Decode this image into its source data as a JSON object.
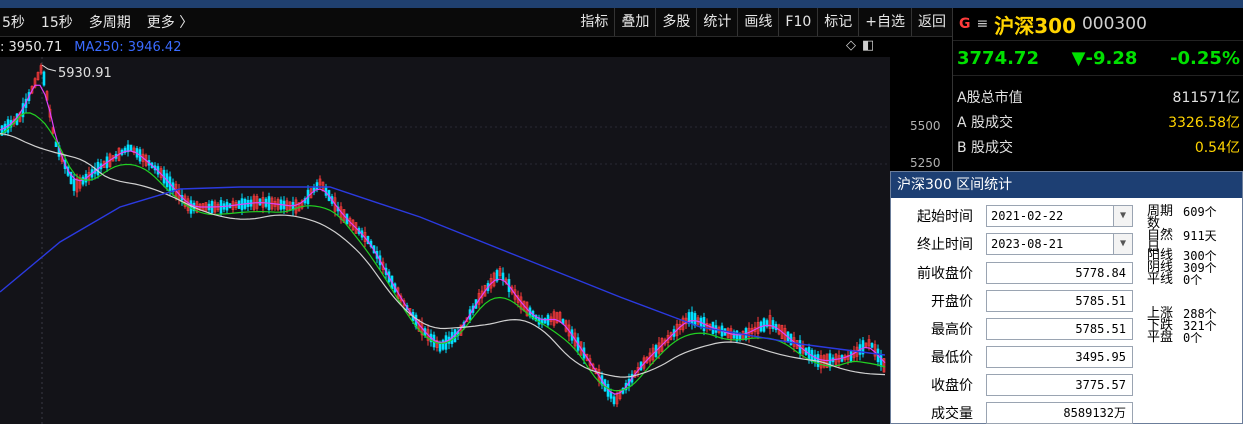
{
  "toolbar": {
    "left": [
      "5秒",
      "15秒",
      "多周期",
      "更多 〉"
    ],
    "right": [
      "指标",
      "叠加",
      "多股",
      "统计",
      "画线",
      "F10",
      "标记",
      "+自选",
      "返回"
    ]
  },
  "ma_line": {
    "ma1": ": 3950.71",
    "ma2": "MA250: 3946.42"
  },
  "chart": {
    "peak_label": "5930.91",
    "y_ticks": [
      "5500",
      "5250"
    ]
  },
  "quote": {
    "g_badge": "G",
    "menu_glyph": "≡",
    "name": "沪深300",
    "code": "000300",
    "price": "3774.72",
    "change": "▼-9.28",
    "pct": "-0.25%",
    "rows": [
      {
        "label": "A股总市值",
        "value": "811571亿",
        "yellow": false
      },
      {
        "label": "A 股成交",
        "value": "3326.58亿",
        "yellow": true
      },
      {
        "label": "B 股成交",
        "value": "0.54亿",
        "yellow": true
      }
    ]
  },
  "dialog": {
    "title": "沪深300 区间统计",
    "start_label": "起始时间",
    "start_value": "2021-02-22",
    "end_label": "终止时间",
    "end_value": "2023-08-21",
    "fields": [
      {
        "label": "前收盘价",
        "value": "5778.84"
      },
      {
        "label": "开盘价",
        "value": "5785.51"
      },
      {
        "label": "最高价",
        "value": "5785.51"
      },
      {
        "label": "最低价",
        "value": "3495.95"
      },
      {
        "label": "收盘价",
        "value": "3775.57"
      },
      {
        "label": "成交量",
        "value": "8589132万"
      }
    ],
    "stats_a": [
      {
        "k": "周期数",
        "v": "609个"
      },
      {
        "k": "自然日",
        "v": "911天"
      }
    ],
    "stats_b": [
      {
        "k": "阳线",
        "v": "300个"
      },
      {
        "k": "阴线",
        "v": "309个"
      },
      {
        "k": "平线",
        "v": "0个"
      }
    ],
    "stats_c": [
      {
        "k": "上涨",
        "v": "288个"
      },
      {
        "k": "下跌",
        "v": "321个"
      },
      {
        "k": "平盘",
        "v": "0个"
      }
    ]
  },
  "colors": {
    "up": "#ff3b3b",
    "down": "#00e0ff",
    "ma_white": "#d0d0d0",
    "ma_purple": "#e040fb",
    "ma_green": "#22d022",
    "ma_blue": "#2b3ae0"
  }
}
